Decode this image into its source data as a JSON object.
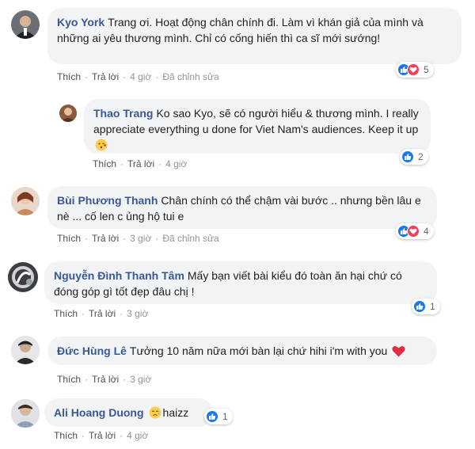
{
  "comments": [
    {
      "author": "Kyo York",
      "text": "Trang ơi. Hoạt động chân chính đi. Làm vì khán giả của mình và những ai yêu thương mình. Chỉ có cống hiến thì ca sĩ mới sướng!",
      "like": "Thích",
      "reply": "Trả lời",
      "time": "4 giờ",
      "edited": "Đã chỉnh sửa",
      "reactions": [
        "like",
        "love"
      ],
      "reaction_count": "5"
    },
    {
      "author": "Thao Trang",
      "text": "Ko sao Kyo, sẽ có người hiểu & thương mình. I really appreciate everything u done for Viet Nam's audiences. Keep it up",
      "like": "Thích",
      "reply": "Trả lời",
      "time": "4 giờ",
      "reactions": [
        "like"
      ],
      "reaction_count": "2",
      "emoji": "kissing-heart-emoji"
    },
    {
      "author": "Bùi Phương Thanh",
      "text": "Chân chính có thể chậm vài bước .. nhưng bền lâu e nè ... cố len c ủng hộ tui e",
      "like": "Thích",
      "reply": "Trả lời",
      "time": "3 giờ",
      "edited": "Đã chỉnh sửa",
      "reactions": [
        "like",
        "love"
      ],
      "reaction_count": "4"
    },
    {
      "author": "Nguyễn Đình Thanh Tâm",
      "text": "Mấy bạn viết bài kiểu đó toàn ăn hại chứ có đóng góp gì tốt đẹp đâu chị !",
      "like": "Thích",
      "reply": "Trả lời",
      "time": "3 giờ",
      "reactions": [
        "like"
      ],
      "reaction_count": "1"
    },
    {
      "author": "Đức Hùng Lê",
      "text": "Tưởng 10 năm nữa mới bàn lại chứ hihi i'm with you",
      "like": "Thích",
      "reply": "Trả lời",
      "time": "3 giờ",
      "emoji": "red-heart-emoji"
    },
    {
      "author": "Ali Hoang Duong",
      "text": "haizz",
      "like": "Thích",
      "reply": "Trả lời",
      "time": "4 giờ",
      "reactions": [
        "like"
      ],
      "reaction_count": "1",
      "emoji": "sad-face-emoji"
    }
  ],
  "colors": {
    "author": "#385898",
    "bubble": "#f2f3f5",
    "like": "#1877f2",
    "love": "#f33e58",
    "meta": "#90949c"
  }
}
